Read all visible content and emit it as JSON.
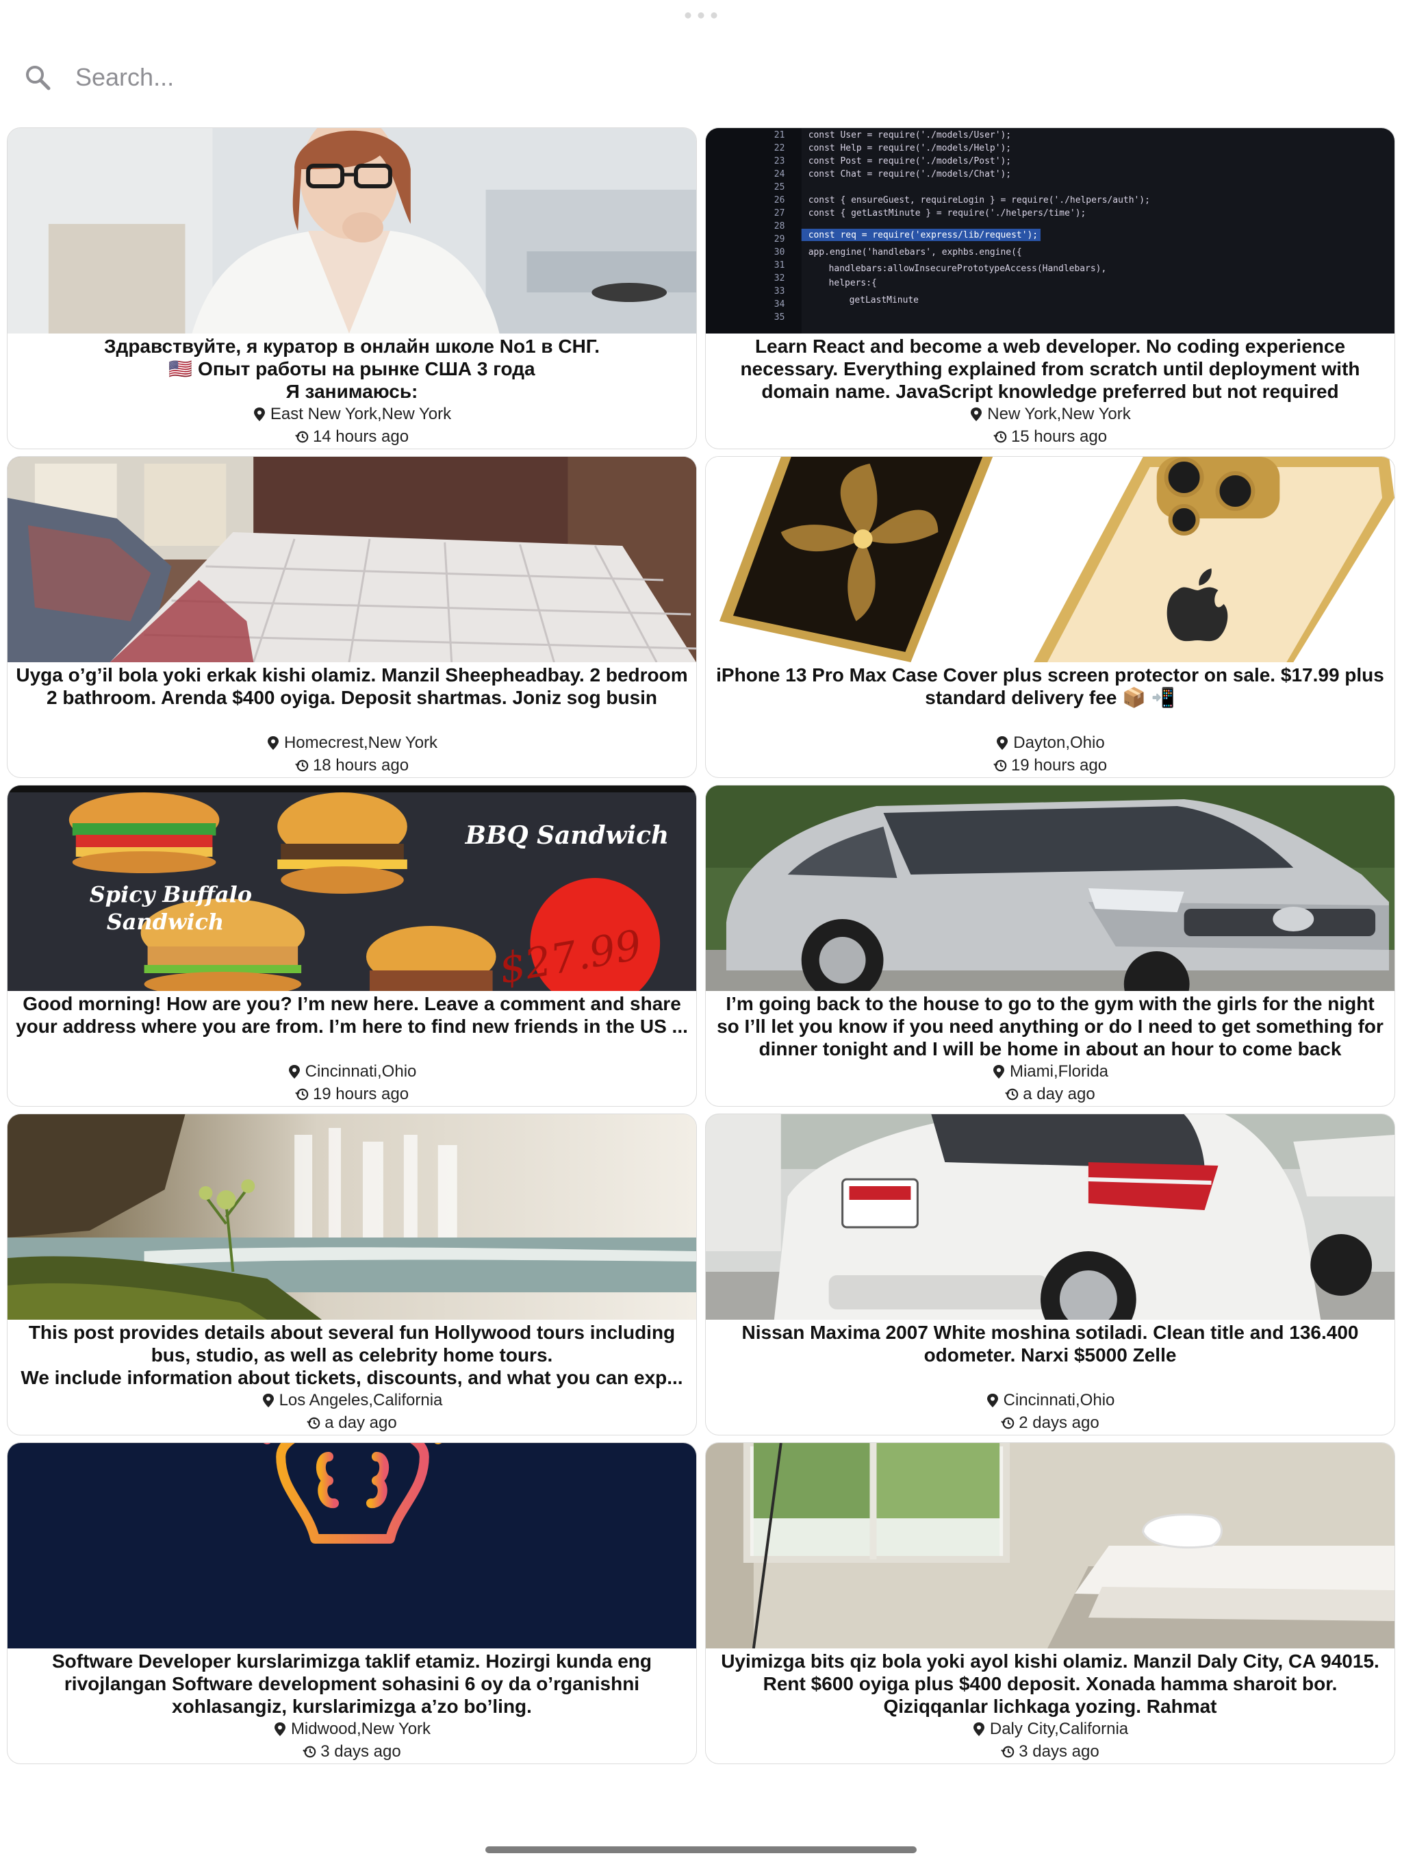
{
  "search": {
    "placeholder": "Search..."
  },
  "posts": [
    {
      "title": "Здравствуйте, я куратор в онлайн школе No1 в СНГ.\n🇺🇸 Опыт работы на рынке США 3 года\nЯ занимаюсь:",
      "location": "East New York,New York",
      "time": "14 hours ago",
      "image": "woman-portrait"
    },
    {
      "title": "Learn React and become a web developer. No coding experience necessary. Everything explained from scratch until deployment with domain name. JavaScript knowledge preferred but not required",
      "location": "New York,New York",
      "time": "15 hours ago",
      "image": "code-screen",
      "code_lines": [
        "const User = require('./models/User');",
        "const Help = require('./models/Help');",
        "const Post = require('./models/Post');",
        "const Chat = require('./models/Chat');",
        "const { ensureGuest, requireLogin } = require('./helpers/auth');",
        "const { getLastMinute } = require('./helpers/time');",
        "const req = require('express/lib/request');",
        "app.engine('handlebars', exphbs.engine({",
        "handlebars:allowInsecurePrototypeAccess(Handlebars),",
        "helpers:{",
        "getLastMinute"
      ]
    },
    {
      "title": "Uyga o’g’il bola yoki erkak kishi olamiz. Manzil Sheepheadbay. 2 bedroom 2 bathroom. Arenda $400 oyiga. Deposit shartmas. Joniz sog busin",
      "location": "Homecrest,New York",
      "time": "18 hours ago",
      "image": "bedroom-mattress"
    },
    {
      "title": "iPhone 13 Pro Max Case Cover plus screen protector on sale. $17.99 plus standard delivery fee 📦 📲",
      "location": "Dayton,Ohio",
      "time": "19 hours ago",
      "image": "phone-case"
    },
    {
      "title": "Good morning! How are you? I’m new here. Leave a comment and share your address where you are from. I’m here to find new friends in the US ...",
      "location": "Cincinnati,Ohio",
      "time": "19 hours ago",
      "image": "sandwich-menu",
      "image_text": [
        "BBQ Sandwich",
        "Spicy Buffalo",
        "Sandwich",
        "$27.99"
      ]
    },
    {
      "title": "I’m going back to the house to go to the gym with the girls for the night so I’ll let you know if you need anything or do I need to get something for dinner tonight and I will be home in about an hour to come back",
      "location": "Miami,Florida",
      "time": "a day ago",
      "image": "silver-car"
    },
    {
      "title": "This post provides details about several fun Hollywood tours including bus, studio, as well as celebrity home tours.\nWe include information about tickets, discounts, and what you can exp...",
      "location": "Los Angeles,California",
      "time": "a day ago",
      "image": "waterfall"
    },
    {
      "title": "Nissan Maxima 2007 White moshina sotiladi. Clean title and 136.400 odometer. Narxi $5000 Zelle",
      "location": "Cincinnati,Ohio",
      "time": "2 days ago",
      "image": "white-car"
    },
    {
      "title": "Software Developer kurslarimizga taklif etamiz. Hozirgi kunda eng rivojlangan Software development sohasini 6 oy da o’rganishni xohlasangiz, kurslarimizga a’zo bo’ling.",
      "location": "Midwood,New York",
      "time": "3 days ago",
      "image": "lightbulb-logo"
    },
    {
      "title": "Uyimizga bits qiz bola yoki ayol kishi olamiz. Manzil Daly City, CA 94015. Rent $600 oyiga plus $400 deposit. Xonada hamma sharoit bor. Qiziqqanlar lichkaga yozing. Rahmat",
      "location": "Daly City,California",
      "time": "3 days ago",
      "image": "empty-room"
    }
  ]
}
